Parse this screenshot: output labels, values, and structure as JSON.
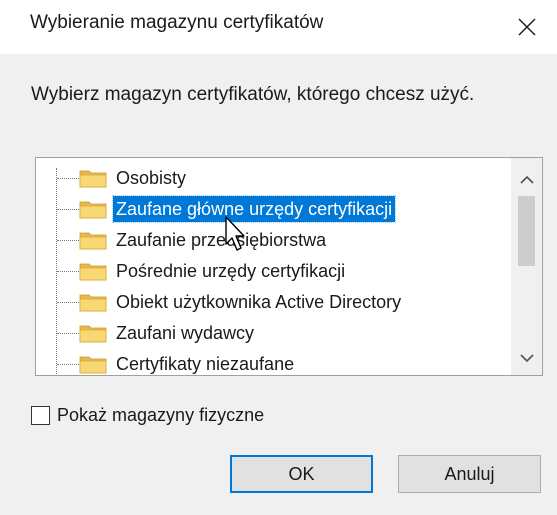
{
  "window": {
    "title": "Wybieranie magazynu certyfikatów",
    "close_icon": "close-icon"
  },
  "prompt": "Wybierz magazyn certyfikatów, którego chcesz użyć.",
  "tree": {
    "items": [
      {
        "label": "Osobisty",
        "selected": false
      },
      {
        "label": "Zaufane główne urzędy certyfikacji",
        "selected": true
      },
      {
        "label": "Zaufanie przedsiębiorstwa",
        "selected": false
      },
      {
        "label": "Pośrednie urzędy certyfikacji",
        "selected": false
      },
      {
        "label": "Obiekt użytkownika Active Directory",
        "selected": false
      },
      {
        "label": "Zaufani wydawcy",
        "selected": false
      },
      {
        "label": "Certyfikaty niezaufane",
        "selected": false
      }
    ],
    "folder_icon": "folder-icon",
    "folder_color": "#f8d775"
  },
  "checkbox": {
    "label": "Pokaż magazyny fizyczne",
    "checked": false
  },
  "buttons": {
    "ok_label": "OK",
    "cancel_label": "Anuluj"
  },
  "colors": {
    "selection": "#0078d7",
    "default_button_border": "#0078d7"
  }
}
